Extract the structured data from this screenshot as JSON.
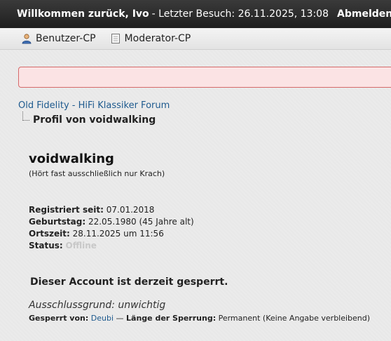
{
  "topbar": {
    "welcome": "Willkommen zurück, Ivo",
    "last_visit": "- Letzter Besuch: 26.11.2025, 13:08",
    "logout": "Abmelden"
  },
  "cpbar": {
    "items": [
      {
        "label": "Benutzer-CP",
        "icon": "user-icon"
      },
      {
        "label": "Moderator-CP",
        "icon": "document-icon"
      }
    ]
  },
  "breadcrumb": {
    "forum": "Old Fidelity - HiFi Klassiker Forum",
    "current": "Profil von voidwalking"
  },
  "profile": {
    "username": "voidwalking",
    "usertitle": "(Hört fast ausschließlich nur Krach)",
    "registered_label": "Registriert seit:",
    "registered": "07.01.2018",
    "birthday_label": "Geburtstag:",
    "birthday": "22.05.1980 (45 Jahre alt)",
    "localtime_label": "Ortszeit:",
    "localtime": "28.11.2025 um 11:56",
    "status_label": "Status:",
    "status": "Offline"
  },
  "ban": {
    "message": "Dieser Account ist derzeit gesperrt.",
    "reason": "Ausschlussgrund: unwichtig",
    "by_label": "Gesperrt von:",
    "by": "Deubi",
    "separator": "—",
    "length_label": "Länge der Sperrung:",
    "length": "Permanent (Keine Angabe verbleibend)"
  }
}
